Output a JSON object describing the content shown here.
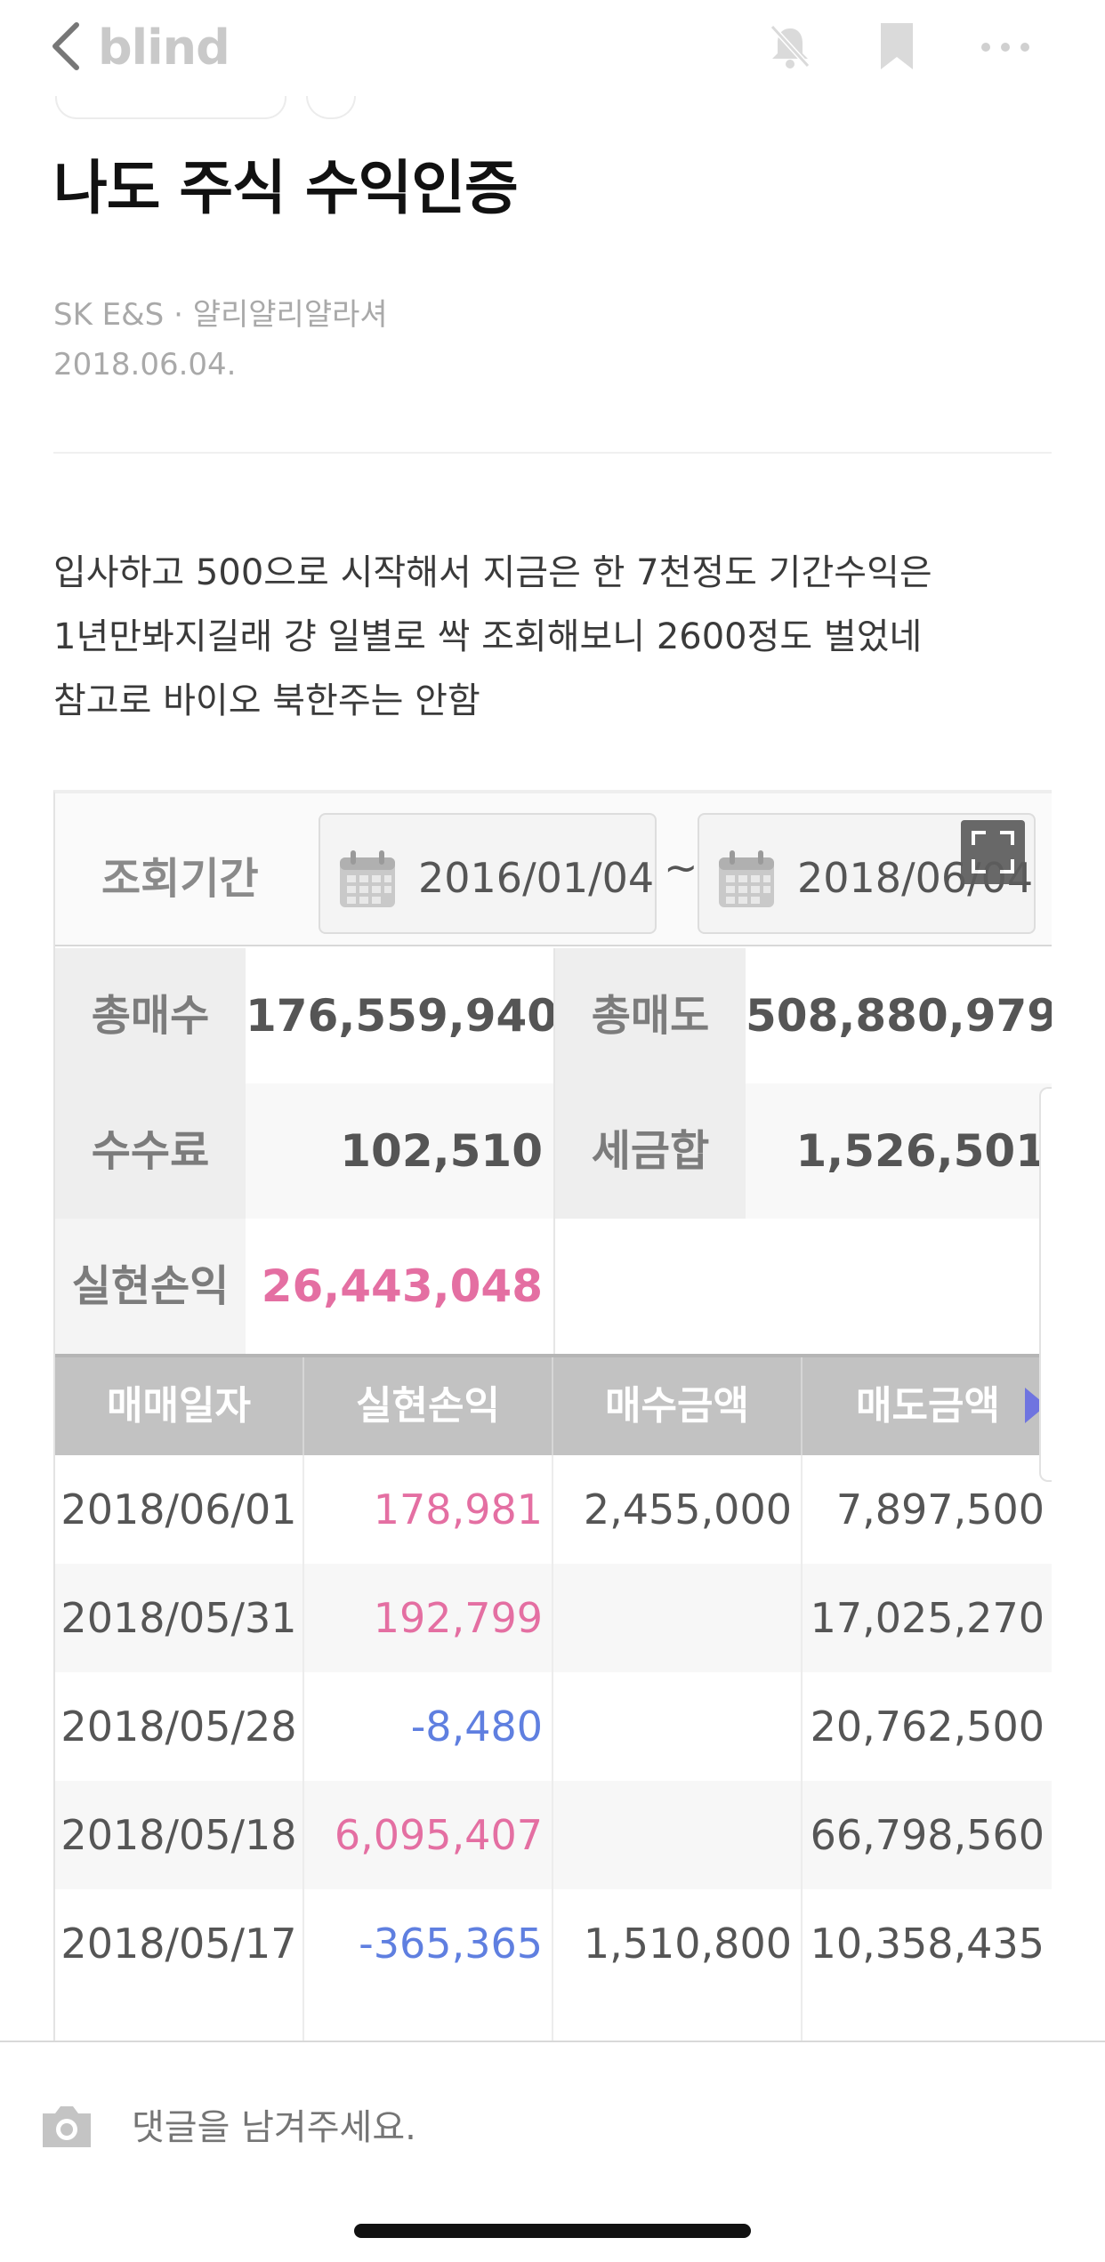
{
  "app": {
    "logo": "blind"
  },
  "post": {
    "title": "나도 주식 수익인증",
    "company": "SK E&S",
    "separator": "·",
    "author": "얄리얄리얄라셔",
    "date": "2018.06.04.",
    "body": [
      "입사하고 500으로 시작해서 지금은 한 7천정도 기간수익은",
      "1년만봐지길래 걍 일별로 싹 조회해보니 2600정도 벌었네",
      "참고로 바이오 북한주는 안함"
    ]
  },
  "screenshot": {
    "period_label": "조회기간",
    "start_date": "2016/01/04",
    "tilde": "~",
    "end_date": "2018/06/04",
    "summary": {
      "total_buy_label": "총매수",
      "total_buy": "176,559,940",
      "total_sell_label": "총매도",
      "total_sell": "508,880,979",
      "fee_label": "수수료",
      "fee": "102,510",
      "tax_label": "세금합",
      "tax": "1,526,501",
      "realized_label": "실현손익",
      "realized": "26,443,048"
    },
    "table": {
      "headers": [
        "매매일자",
        "실현손익",
        "매수금액",
        "매도금액"
      ],
      "rows": [
        {
          "date": "2018/06/01",
          "pnl": "178,981",
          "buy": "2,455,000",
          "sell": "7,897,500",
          "sign": "pos"
        },
        {
          "date": "2018/05/31",
          "pnl": "192,799",
          "buy": "",
          "sell": "17,025,270",
          "sign": "pos"
        },
        {
          "date": "2018/05/28",
          "pnl": "-8,480",
          "buy": "",
          "sell": "20,762,500",
          "sign": "neg"
        },
        {
          "date": "2018/05/18",
          "pnl": "6,095,407",
          "buy": "",
          "sell": "66,798,560",
          "sign": "pos"
        },
        {
          "date": "2018/05/17",
          "pnl": "-365,365",
          "buy": "1,510,800",
          "sell": "10,358,435",
          "sign": "neg"
        }
      ]
    }
  },
  "comment": {
    "placeholder": "댓글을 남겨주세요."
  },
  "colors": {
    "positive": "#e46fa2",
    "negative": "#5f7fe0",
    "header_bg": "#c2c2c2",
    "muted": "#a9a9a9"
  }
}
